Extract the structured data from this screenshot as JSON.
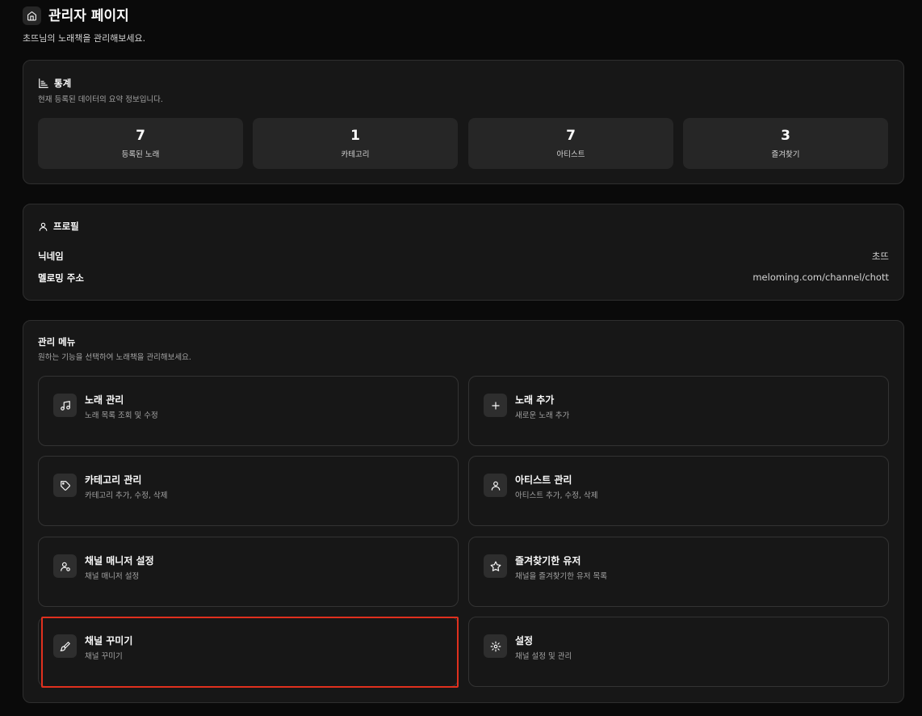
{
  "header": {
    "title": "관리자 페이지",
    "subtitle": "초뜨님의 노래책을 관리해보세요."
  },
  "stats": {
    "title": "통계",
    "description": "현재 등록된 데이터의 요약 정보입니다.",
    "items": [
      {
        "value": "7",
        "label": "등록된 노래"
      },
      {
        "value": "1",
        "label": "카테고리"
      },
      {
        "value": "7",
        "label": "아티스트"
      },
      {
        "value": "3",
        "label": "즐겨찾기"
      }
    ]
  },
  "profile": {
    "title": "프로필",
    "rows": [
      {
        "label": "닉네임",
        "value": "초뜨"
      },
      {
        "label": "멜로밍 주소",
        "value": "meloming.com/channel/chott"
      }
    ]
  },
  "menu": {
    "title": "관리 메뉴",
    "description": "원하는 기능을 선택하여 노래책을 관리해보세요.",
    "items": [
      {
        "title": "노래 관리",
        "desc": "노래 목록 조회 및 수정",
        "icon": "music-icon"
      },
      {
        "title": "노래 추가",
        "desc": "새로운 노래 추가",
        "icon": "plus-icon"
      },
      {
        "title": "카테고리 관리",
        "desc": "카테고리 추가, 수정, 삭제",
        "icon": "tag-icon"
      },
      {
        "title": "아티스트 관리",
        "desc": "아티스트 추가, 수정, 삭제",
        "icon": "user-icon"
      },
      {
        "title": "채널 매니저 설정",
        "desc": "채널 매니저 설정",
        "icon": "user-cog-icon"
      },
      {
        "title": "즐겨찾기한 유저",
        "desc": "채널을 즐겨찾기한 유저 목록",
        "icon": "star-icon"
      },
      {
        "title": "채널 꾸미기",
        "desc": "채널 꾸미기",
        "icon": "brush-icon"
      },
      {
        "title": "설정",
        "desc": "채널 설정 및 관리",
        "icon": "gear-icon"
      }
    ]
  },
  "colors": {
    "background": "#0a0a0a",
    "card": "#171717",
    "highlight": "#e0301e"
  }
}
